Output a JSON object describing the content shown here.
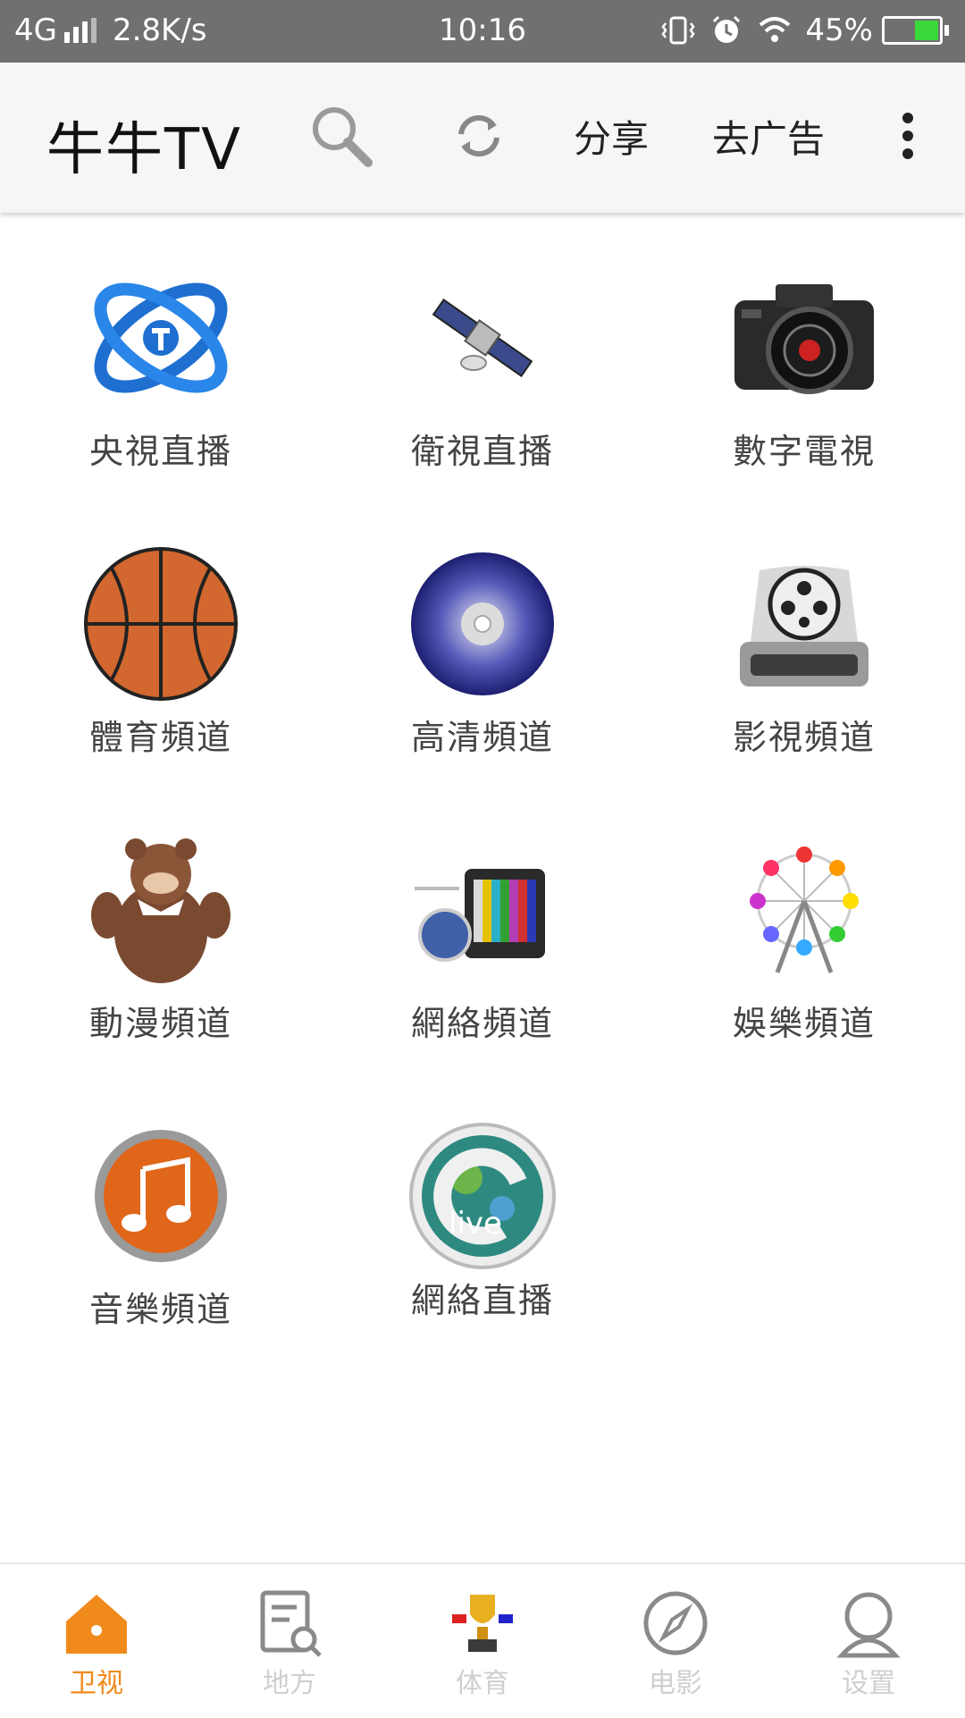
{
  "status_bar": {
    "network": "4G",
    "speed": "2.8K/s",
    "time": "10:16",
    "battery": "45%",
    "battery_level": 0.45,
    "icons": [
      "signal-icon",
      "vibrate-icon",
      "alarm-icon",
      "wifi-icon",
      "battery-icon"
    ]
  },
  "toolbar": {
    "title": "牛牛TV",
    "share_label": "分享",
    "remove_ads_label": "去广告",
    "icons": [
      "search-icon",
      "refresh-icon",
      "more-menu-icon"
    ]
  },
  "channels": [
    {
      "label": "央視直播",
      "icon": "cctv-logo-icon"
    },
    {
      "label": "衛視直播",
      "icon": "satellite-icon"
    },
    {
      "label": "數字電視",
      "icon": "camera-icon"
    },
    {
      "label": "體育頻道",
      "icon": "basketball-icon"
    },
    {
      "label": "高清頻道",
      "icon": "disc-icon"
    },
    {
      "label": "影視頻道",
      "icon": "film-reel-drive-icon"
    },
    {
      "label": "動漫頻道",
      "icon": "cartoon-bear-icon"
    },
    {
      "label": "網絡頻道",
      "icon": "retro-tv-icon"
    },
    {
      "label": "娛樂頻道",
      "icon": "ferris-wheel-icon"
    },
    {
      "label": "音樂頻道",
      "icon": "music-note-icon"
    },
    {
      "label": "網絡直播",
      "icon": "live-globe-icon"
    }
  ],
  "bottom_nav": [
    {
      "label": "卫视",
      "icon": "home-icon",
      "active": true
    },
    {
      "label": "地方",
      "icon": "local-search-icon",
      "active": false
    },
    {
      "label": "体育",
      "icon": "trophy-icon",
      "active": false
    },
    {
      "label": "电影",
      "icon": "compass-icon",
      "active": false
    },
    {
      "label": "设置",
      "icon": "user-icon",
      "active": false
    }
  ],
  "colors": {
    "status_bar": "#707070",
    "toolbar": "#f6f6f6",
    "accent": "#f08a1c",
    "inactive": "#cfcfcf"
  }
}
